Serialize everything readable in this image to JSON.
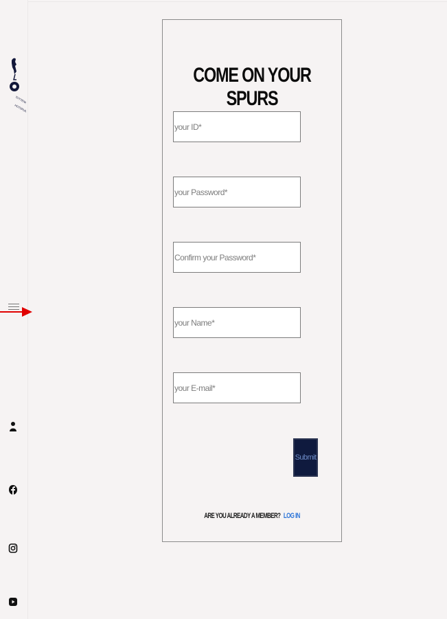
{
  "form": {
    "title": "COME ON YOUR SPURS",
    "fields": [
      {
        "name": "id-field",
        "placeholder": "your ID*"
      },
      {
        "name": "password-field",
        "placeholder": "your Password*"
      },
      {
        "name": "confirm-password-field",
        "placeholder": "Confirm your Password*"
      },
      {
        "name": "name-field",
        "placeholder": "your Name*"
      },
      {
        "name": "email-field",
        "placeholder": "your E-mail*"
      }
    ],
    "submit_label": "Submit",
    "member_question": "ARE YOU ALREADY A MEMBER?",
    "login_label": "LOG IN"
  },
  "sidebar": {
    "icons": [
      "spurs-logo-icon",
      "menu-icon",
      "user-icon",
      "facebook-icon",
      "instagram-icon",
      "youtube-icon"
    ]
  },
  "colors": {
    "background": "#f6f3f3",
    "navy": "#0f1a3e",
    "link_blue": "#2a73d8",
    "arrow_red": "#e00000"
  }
}
